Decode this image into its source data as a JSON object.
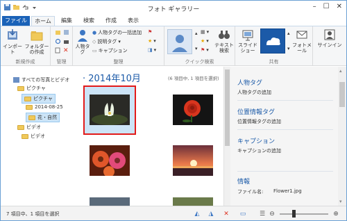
{
  "window": {
    "title": "フォト ギャラリー"
  },
  "tabs": [
    "ファイル",
    "ホーム",
    "編集",
    "検索",
    "作成",
    "表示"
  ],
  "ribbon": {
    "groups": {
      "new": "新規作成",
      "manage": "管理",
      "organize": "整理",
      "quick_find": "クイック検索",
      "share": "共有"
    },
    "import_label": "インポート",
    "new_folder_label": "フォルダーの作成",
    "people_tag_label": "人物タグ",
    "batch_people_tag": "人物タグの一括追加",
    "caption_tag": "説明タグ",
    "caption": "キャプション",
    "text_search": "テキスト検索",
    "slideshow": "スライドショー",
    "photo_email": "フォトメール",
    "sign_in": "サインイン"
  },
  "nav": {
    "all": "すべての写真とビデオ",
    "pictures": "ピクチャ",
    "pictures_sub": "ピクチャ",
    "folder1": "2014-08-25",
    "folder2": "花・自然",
    "videos": "ビデオ",
    "videos_sub": "ビデオ"
  },
  "content": {
    "date_header": "2014年10月",
    "count": "(6 項目中, 1 項目を選択)",
    "thumbnails": [
      "lotus",
      "rose",
      "gerbera",
      "sunset_beach",
      "item5",
      "item6"
    ]
  },
  "details": {
    "people_tag_heading": "人物タグ",
    "people_tag_add": "人物タグの追加",
    "geotag_heading": "位置情報タグ",
    "geotag_add": "位置情報タグの追加",
    "caption_heading": "キャプション",
    "caption_add": "キャプションの追加",
    "info_heading": "情報",
    "filename_label": "ファイル名:",
    "filename_value": "Flower1.jpg"
  },
  "status": {
    "text": "7 項目中、1 項目を選択"
  },
  "colors": {
    "accent": "#1b5aa8",
    "file_tab": "#1a62b8",
    "selection_border": "#e21a1a"
  }
}
